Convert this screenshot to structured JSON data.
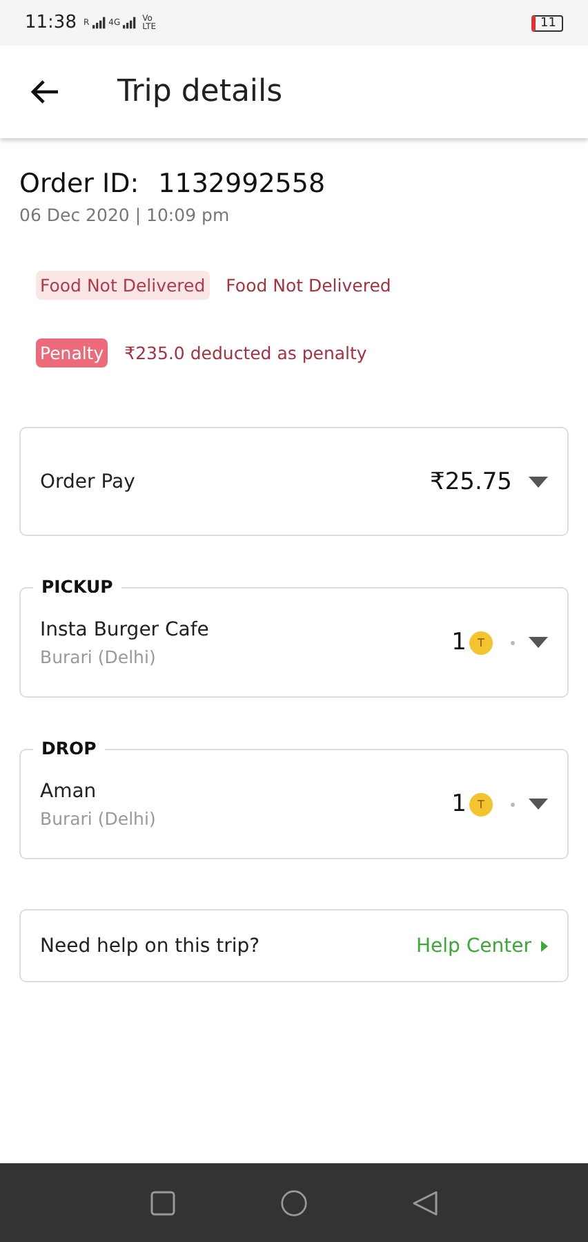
{
  "status_bar": {
    "time": "11:38",
    "roaming": "R",
    "network": "4G",
    "volte_top": "Vo",
    "volte_bottom": "LTE",
    "battery": "11"
  },
  "header": {
    "title": "Trip details"
  },
  "order": {
    "label": "Order ID:",
    "id": "1132992558",
    "datetime": "06 Dec 2020 | 10:09 pm"
  },
  "status": {
    "tag": "Food Not Delivered",
    "text": "Food Not Delivered"
  },
  "penalty": {
    "tag": "Penalty",
    "text": "₹235.0 deducted as penalty"
  },
  "order_pay": {
    "label": "Order Pay",
    "amount": "₹25.75"
  },
  "stops": [
    {
      "section": "PICKUP",
      "name": "Insta Burger Cafe",
      "area": "Burari (Delhi)",
      "count": "1",
      "badge": "T"
    },
    {
      "section": "DROP",
      "name": "Aman",
      "area": "Burari (Delhi)",
      "count": "1",
      "badge": "T"
    }
  ],
  "help": {
    "question": "Need help on this trip?",
    "link": "Help Center"
  }
}
